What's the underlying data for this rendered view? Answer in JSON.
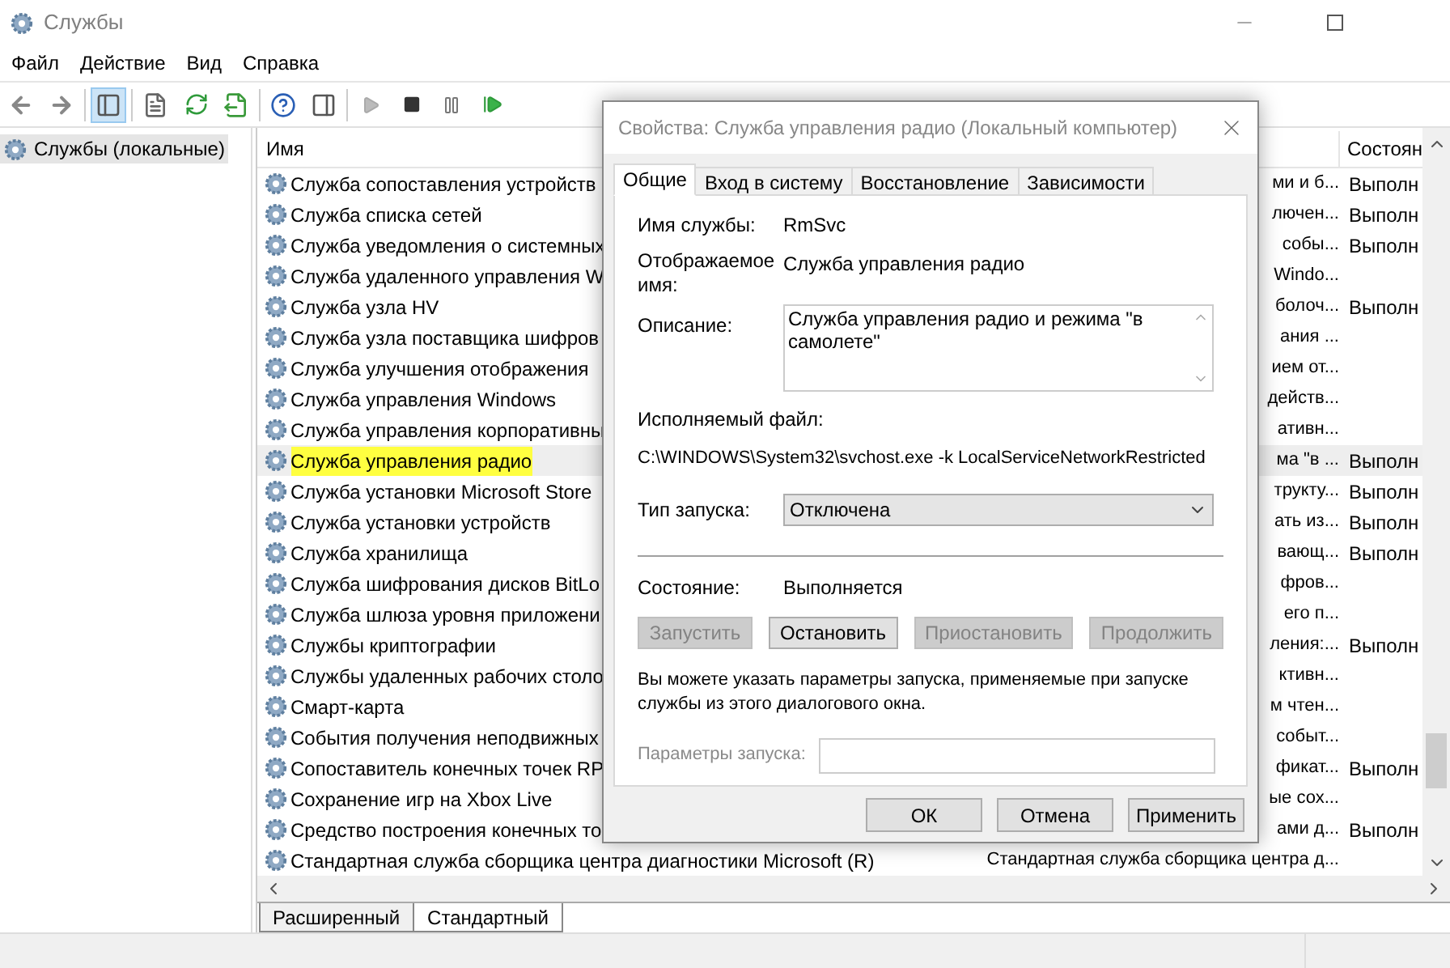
{
  "window": {
    "title": "Службы"
  },
  "menu": [
    "Файл",
    "Действие",
    "Вид",
    "Справка"
  ],
  "toolbar": {
    "console_tree_selected": true
  },
  "tree": [
    {
      "label": "Службы (локальные)",
      "selected": true
    }
  ],
  "table": {
    "columns": [
      "Имя",
      "Состоян"
    ],
    "rows": [
      {
        "name": "Служба сопоставления устройств",
        "description": "ми и б...",
        "status": "Выполн",
        "selected": false
      },
      {
        "name": "Служба списка сетей",
        "description": "лючен...",
        "status": "Выполн",
        "selected": false
      },
      {
        "name": "Служба уведомления о системных",
        "description": "собы...",
        "status": "Выполн",
        "selected": false
      },
      {
        "name": "Служба удаленного управления W",
        "description": "Windo...",
        "selected": false
      },
      {
        "name": "Служба узла HV",
        "description": "болоч...",
        "status": "Выполн",
        "selected": false
      },
      {
        "name": "Служба узла поставщика шифров",
        "description": "ания ...",
        "selected": false
      },
      {
        "name": "Служба улучшения отображения",
        "description": "ием от...",
        "selected": false
      },
      {
        "name": "Служба управления Windows",
        "description": "действ...",
        "selected": false
      },
      {
        "name": "Служба управления корпоративны",
        "description": "ативн...",
        "selected": false
      },
      {
        "name": "Служба управления радио",
        "description": "ма \"в ...",
        "status": "Выполн",
        "selected": true
      },
      {
        "name": "Служба установки Microsoft Store",
        "description": "трукту...",
        "status": "Выполн",
        "selected": false
      },
      {
        "name": "Служба установки устройств",
        "description": "ать из...",
        "status": "Выполн",
        "selected": false
      },
      {
        "name": "Служба хранилища",
        "description": "вающ...",
        "status": "Выполн",
        "selected": false
      },
      {
        "name": "Служба шифрования дисков BitLo",
        "description": "фров...",
        "selected": false
      },
      {
        "name": "Служба шлюза уровня приложени",
        "description": "его п...",
        "selected": false
      },
      {
        "name": "Службы криптографии",
        "description": "ления:...",
        "status": "Выполн",
        "selected": false
      },
      {
        "name": "Службы удаленных рабочих столо",
        "description": "ктивн...",
        "selected": false
      },
      {
        "name": "Смарт-карта",
        "description": "м чтен...",
        "selected": false
      },
      {
        "name": "События получения неподвижных",
        "description": "событ...",
        "selected": false
      },
      {
        "name": "Сопоставитель конечных точек RP",
        "description": "фикат...",
        "status": "Выполн",
        "selected": false
      },
      {
        "name": "Сохранение игр на Xbox Live",
        "description": "ые сох...",
        "selected": false
      },
      {
        "name": "Средство построения конечных то",
        "description": "ами д...",
        "status": "Выполн",
        "selected": false
      },
      {
        "name": "Стандартная служба сборщика центра диагностики Microsoft (R)",
        "description": "Стандартная служба сборщика центра д...",
        "selected": false
      }
    ]
  },
  "view_tabs": [
    {
      "label": "Расширенный",
      "selected": false
    },
    {
      "label": "Стандартный",
      "selected": true
    }
  ],
  "dialog": {
    "title": "Свойства: Служба управления радио (Локальный компьютер)",
    "tabs": [
      {
        "label": "Общие",
        "selected": true
      },
      {
        "label": "Вход в систему",
        "selected": false
      },
      {
        "label": "Восстановление",
        "selected": false
      },
      {
        "label": "Зависимости",
        "selected": false
      }
    ],
    "service_name_label": "Имя службы:",
    "service_name": "RmSvc",
    "display_name_label": "Отображаемое имя:",
    "display_name": "Служба управления радио",
    "description_label": "Описание:",
    "description": "Служба управления радио и режима \"в самолете\"",
    "executable_label": "Исполняемый файл:",
    "executable": "C:\\WINDOWS\\System32\\svchost.exe -k LocalServiceNetworkRestricted",
    "startup_type_label": "Тип запуска:",
    "startup_type": "Отключена",
    "state_label": "Состояние:",
    "state": "Выполняется",
    "service_buttons": [
      {
        "label": "Запустить",
        "disabled": true
      },
      {
        "label": "Остановить",
        "disabled": false
      },
      {
        "label": "Приостановить",
        "disabled": true
      },
      {
        "label": "Продолжить",
        "disabled": true
      }
    ],
    "hint": "Вы можете указать параметры запуска, применяемые при запуске службы из этого диалогового окна.",
    "parameters_label": "Параметры запуска:",
    "parameters_disabled": true,
    "buttons": [
      "ОК",
      "Отмена",
      "Применить"
    ]
  }
}
